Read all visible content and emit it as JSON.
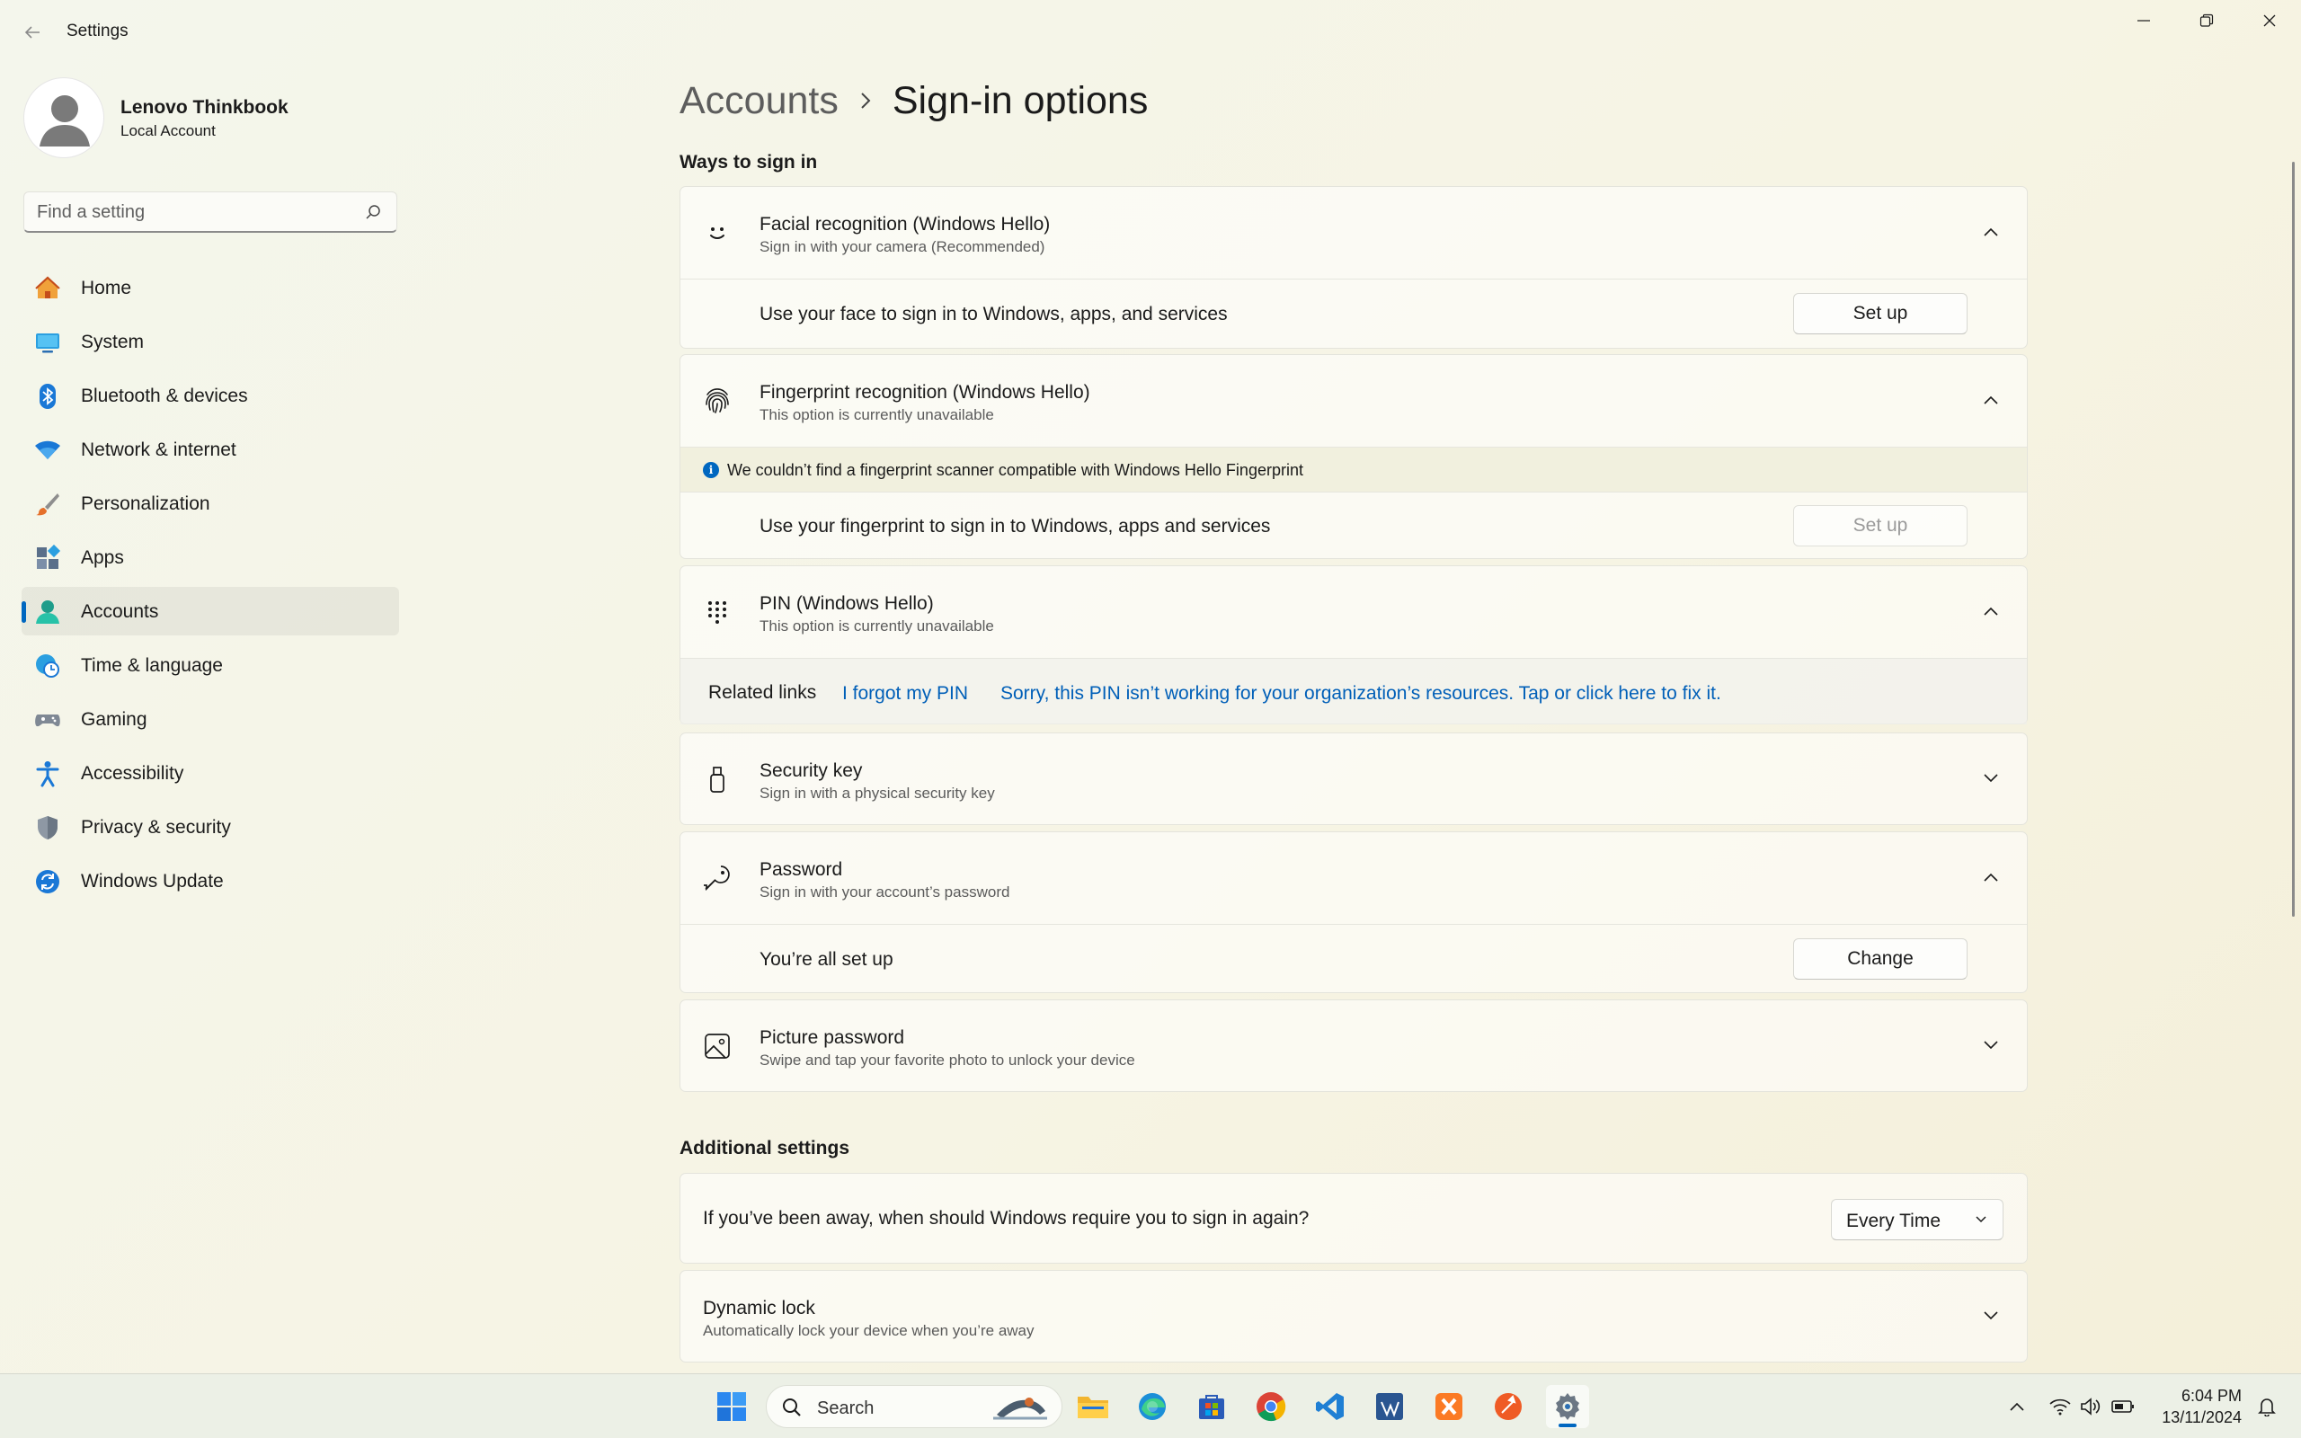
{
  "window": {
    "title": "Settings"
  },
  "profile": {
    "name": "Lenovo Thinkbook",
    "account_type": "Local Account"
  },
  "search": {
    "placeholder": "Find a setting"
  },
  "sidebar": {
    "items": [
      {
        "label": "Home",
        "icon": "home-icon"
      },
      {
        "label": "System",
        "icon": "system-icon"
      },
      {
        "label": "Bluetooth & devices",
        "icon": "bluetooth-icon"
      },
      {
        "label": "Network & internet",
        "icon": "wifi-icon"
      },
      {
        "label": "Personalization",
        "icon": "brush-icon"
      },
      {
        "label": "Apps",
        "icon": "apps-icon"
      },
      {
        "label": "Accounts",
        "icon": "accounts-icon",
        "selected": true
      },
      {
        "label": "Time & language",
        "icon": "globe-clock-icon"
      },
      {
        "label": "Gaming",
        "icon": "gamepad-icon"
      },
      {
        "label": "Accessibility",
        "icon": "accessibility-icon"
      },
      {
        "label": "Privacy & security",
        "icon": "shield-icon"
      },
      {
        "label": "Windows Update",
        "icon": "update-icon"
      }
    ]
  },
  "breadcrumb": {
    "parent": "Accounts",
    "current": "Sign-in options"
  },
  "ways": {
    "heading": "Ways to sign in",
    "facial": {
      "title": "Facial recognition (Windows Hello)",
      "subtitle": "Sign in with your camera (Recommended)",
      "row_text": "Use your face to sign in to Windows, apps, and services",
      "button": "Set up"
    },
    "fingerprint": {
      "title": "Fingerprint recognition (Windows Hello)",
      "subtitle": "This option is currently unavailable",
      "info": "We couldn’t find a fingerprint scanner compatible with Windows Hello Fingerprint",
      "row_text": "Use your fingerprint to sign in to Windows, apps and services",
      "button": "Set up"
    },
    "pin": {
      "title": "PIN (Windows Hello)",
      "subtitle": "This option is currently unavailable",
      "related_label": "Related links",
      "link_forgot": "I forgot my PIN",
      "link_fix": "Sorry, this PIN isn’t working for your organization’s resources. Tap or click here to fix it."
    },
    "security_key": {
      "title": "Security key",
      "subtitle": "Sign in with a physical security key"
    },
    "password": {
      "title": "Password",
      "subtitle": "Sign in with your account’s password",
      "row_text": "You’re all set up",
      "button": "Change"
    },
    "picture_password": {
      "title": "Picture password",
      "subtitle": "Swipe and tap your favorite photo to unlock your device"
    }
  },
  "additional": {
    "heading": "Additional settings",
    "require_signin": {
      "question": "If you’ve been away, when should Windows require you to sign in again?",
      "value": "Every Time"
    },
    "dynamic_lock": {
      "title": "Dynamic lock",
      "subtitle": "Automatically lock your device when you’re away"
    }
  },
  "taskbar": {
    "search_label": "Search",
    "apps": [
      "start-icon",
      "file-explorer-icon",
      "edge-icon",
      "store-icon",
      "chrome-icon",
      "vscode-icon",
      "visual-studio-icon",
      "xampp-icon",
      "postman-icon",
      "settings-icon"
    ],
    "time": "6:04 PM",
    "date": "13/11/2024"
  },
  "colors": {
    "accent": "#0067c0",
    "link": "#005fb8"
  }
}
